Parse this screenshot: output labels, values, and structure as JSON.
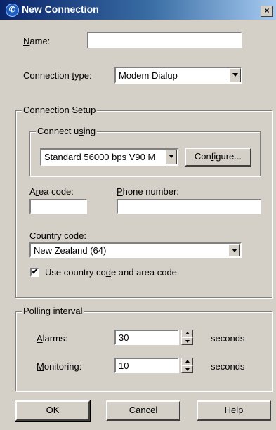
{
  "window": {
    "title": "New Connection",
    "close_glyph": "×"
  },
  "name": {
    "label_pre": "",
    "label_accel": "N",
    "label_post": "ame:",
    "value": ""
  },
  "connection_type": {
    "label_pre": "Connection ",
    "label_accel": "t",
    "label_post": "ype:",
    "value": "Modem Dialup"
  },
  "connection_setup": {
    "legend": "Connection Setup",
    "connect_using": {
      "legend_pre": "Connect u",
      "legend_accel": "s",
      "legend_post": "ing",
      "device": "Standard 56000 bps V90 M",
      "configure_pre": "Con",
      "configure_accel": "f",
      "configure_post": "igure..."
    },
    "area_code": {
      "label_pre": "A",
      "label_accel": "r",
      "label_post": "ea code:",
      "value": ""
    },
    "phone_number": {
      "label_pre": "",
      "label_accel": "P",
      "label_post": "hone number:",
      "value": ""
    },
    "country_code": {
      "label_pre": "Co",
      "label_accel": "u",
      "label_post": "ntry code:",
      "value": "New Zealand (64)"
    },
    "use_country_code": {
      "checked": true,
      "check_glyph": "✔",
      "label_pre": "Use country co",
      "label_accel": "d",
      "label_post": "e and area code"
    }
  },
  "polling": {
    "legend": "Polling interval",
    "alarms": {
      "label_pre": "",
      "label_accel": "A",
      "label_post": "larms:",
      "value": "30",
      "unit": "seconds"
    },
    "monitoring": {
      "label_pre": "",
      "label_accel": "M",
      "label_post": "onitoring:",
      "value": "10",
      "unit": "seconds"
    }
  },
  "buttons": {
    "ok": "OK",
    "cancel": "Cancel",
    "help": "Help"
  },
  "icons": {
    "title": "connection-icon",
    "close": "close-icon",
    "dropdown": "chevron-down-icon",
    "spin_up": "spin-up-icon",
    "spin_down": "spin-down-icon",
    "check": "check-icon"
  }
}
